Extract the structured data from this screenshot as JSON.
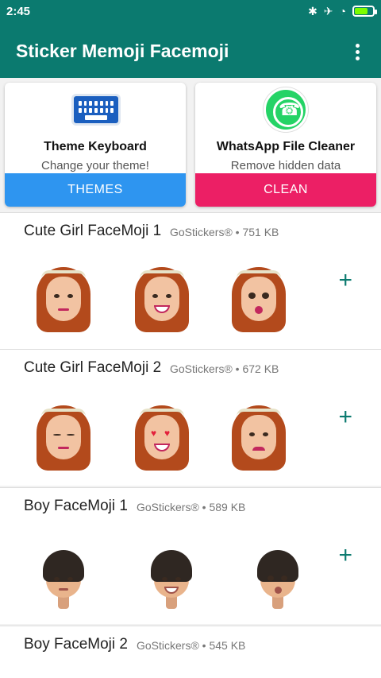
{
  "status": {
    "time": "2:45",
    "icons": [
      "bluetooth-icon",
      "airplane-icon",
      "wifi-icon",
      "battery-charging-icon"
    ]
  },
  "appbar": {
    "title": "Sticker Memoji Facemoji",
    "menu_icon": "more-vert-icon"
  },
  "promos": [
    {
      "icon": "keyboard-icon",
      "title": "Theme Keyboard",
      "subtitle": "Change your theme!",
      "button": "THEMES",
      "color": "#2e95f0"
    },
    {
      "icon": "whatsapp-icon",
      "title": "WhatsApp File Cleaner",
      "subtitle": "Remove hidden data",
      "button": "CLEAN",
      "color": "#ec1f65"
    }
  ],
  "packs": [
    {
      "name": "Cute Girl FaceMoji 1",
      "meta": "GoStickers® • 751 KB",
      "add": "+"
    },
    {
      "name": "Cute Girl FaceMoji 2",
      "meta": "GoStickers® • 672 KB",
      "add": "+"
    },
    {
      "name": "Boy FaceMoji 1",
      "meta": "GoStickers® • 589 KB",
      "add": "+"
    },
    {
      "name": "Boy FaceMoji 2",
      "meta": "GoStickers® • 545 KB",
      "add": "+"
    }
  ],
  "colors": {
    "primary": "#0b7a6f",
    "themes_button": "#2e95f0",
    "clean_button": "#ec1f65"
  }
}
